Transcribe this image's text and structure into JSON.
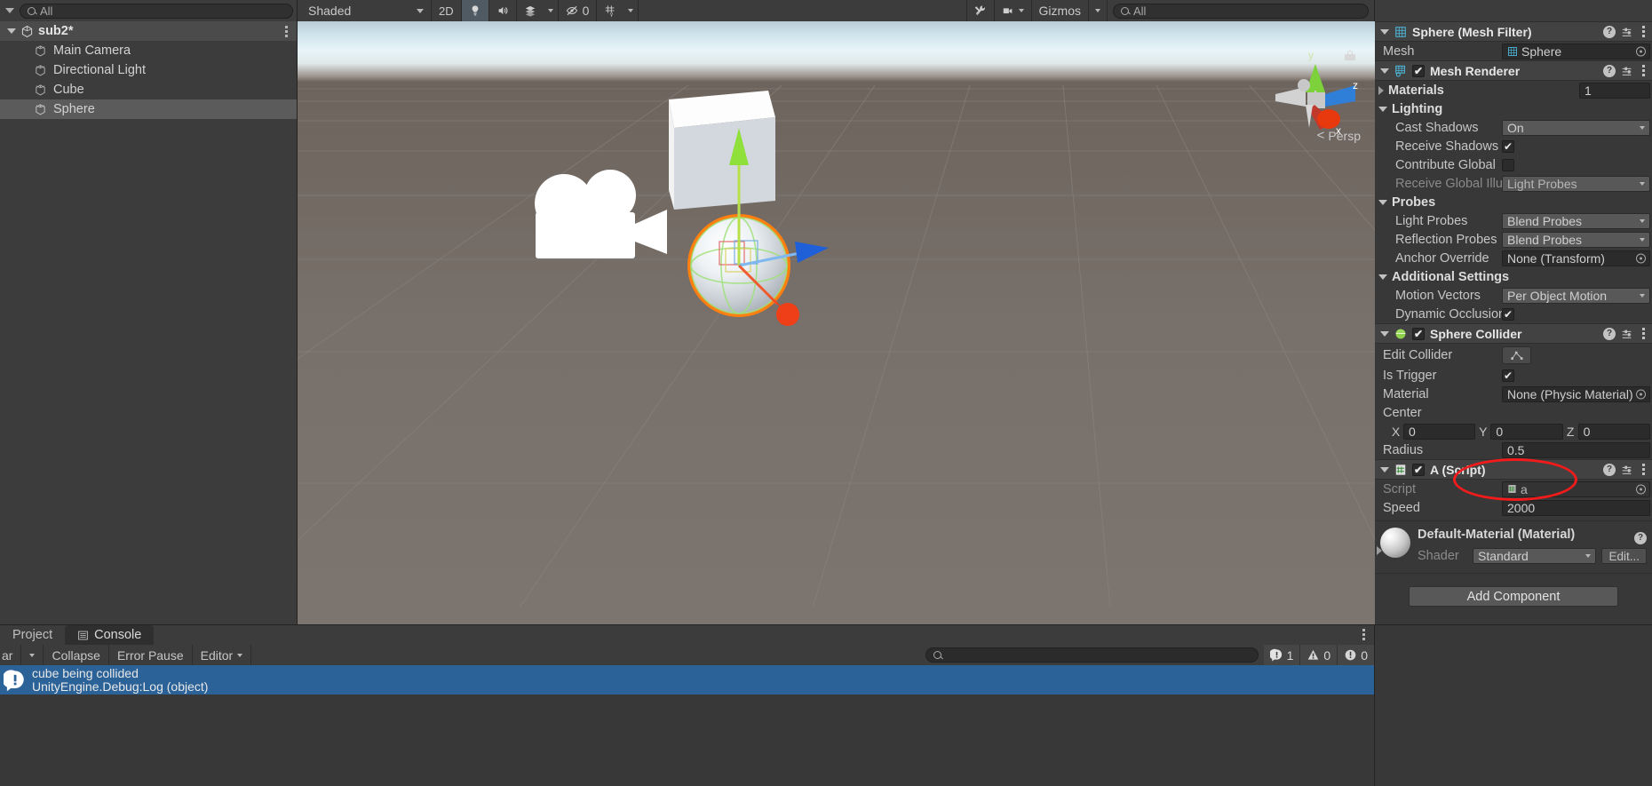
{
  "toolbar": {
    "hierarchy_search_placeholder": "All",
    "shading_mode": "Shaded",
    "view_2d_label": "2D",
    "lighting_icon": "lightbulb-icon",
    "audio_icon": "speaker-icon",
    "fx_icon": "effects-icon",
    "visibility_count": "0",
    "grid_icon": "grid-snap-icon",
    "tools_icon": "tools-icon",
    "camera_icon": "scene-camera-icon",
    "gizmos_label": "Gizmos",
    "gizmos_search_placeholder": "All"
  },
  "hierarchy": {
    "scene_name": "sub2*",
    "items": [
      {
        "label": "Main Camera",
        "selected": false
      },
      {
        "label": "Directional Light",
        "selected": false
      },
      {
        "label": "Cube",
        "selected": false
      },
      {
        "label": "Sphere",
        "selected": true
      }
    ]
  },
  "scene": {
    "projection_label": "Persp",
    "axis_x": "x",
    "axis_y": "y",
    "axis_z": "z"
  },
  "inspector": {
    "mesh_filter": {
      "title": "Sphere (Mesh Filter)",
      "mesh_label": "Mesh",
      "mesh_value": "Sphere"
    },
    "mesh_renderer": {
      "title": "Mesh Renderer",
      "materials_label": "Materials",
      "materials_count": "1",
      "lighting_label": "Lighting",
      "cast_shadows_label": "Cast Shadows",
      "cast_shadows_value": "On",
      "receive_shadows_label": "Receive Shadows",
      "receive_shadows_checked": "✔",
      "contribute_global_label": "Contribute Global",
      "receive_gi_label": "Receive Global Illu",
      "receive_gi_value": "Light Probes",
      "probes_label": "Probes",
      "light_probes_label": "Light Probes",
      "light_probes_value": "Blend Probes",
      "reflection_probes_label": "Reflection Probes",
      "reflection_probes_value": "Blend Probes",
      "anchor_override_label": "Anchor Override",
      "anchor_override_value": "None (Transform)",
      "additional_settings_label": "Additional Settings",
      "motion_vectors_label": "Motion Vectors",
      "motion_vectors_value": "Per Object Motion",
      "dynamic_occlusion_label": "Dynamic Occlusion",
      "dynamic_occlusion_checked": "✔"
    },
    "sphere_collider": {
      "title": "Sphere Collider",
      "edit_collider_label": "Edit Collider",
      "is_trigger_label": "Is Trigger",
      "is_trigger_checked": "✔",
      "material_label": "Material",
      "material_value": "None (Physic Material)",
      "center_label": "Center",
      "center_x_axis": "X",
      "center_x": "0",
      "center_y_axis": "Y",
      "center_y": "0",
      "center_z_axis": "Z",
      "center_z": "0",
      "radius_label": "Radius",
      "radius_value": "0.5"
    },
    "script_component": {
      "title": "A (Script)",
      "script_label": "Script",
      "script_value": "a",
      "speed_label": "Speed",
      "speed_value": "2000"
    },
    "material_preview": {
      "title": "Default-Material (Material)",
      "shader_label": "Shader",
      "shader_value": "Standard",
      "edit_label": "Edit..."
    },
    "add_component_label": "Add Component"
  },
  "console": {
    "tabs": [
      {
        "label": "Project",
        "active": false
      },
      {
        "label": "Console",
        "active": true
      }
    ],
    "clear_label": "ar",
    "collapse_label": "Collapse",
    "error_pause_label": "Error Pause",
    "editor_label": "Editor",
    "search_placeholder": "",
    "counts": {
      "log": "1",
      "warning": "0",
      "error": "0"
    },
    "entries": [
      {
        "message": "cube being collided",
        "detail": "UnityEngine.Debug:Log (object)",
        "selected": true
      }
    ]
  },
  "colors": {
    "accent_selected": "#2b6298",
    "annotation": "#f21b1b",
    "panel_bg": "#383838",
    "header_bg": "#424242"
  }
}
